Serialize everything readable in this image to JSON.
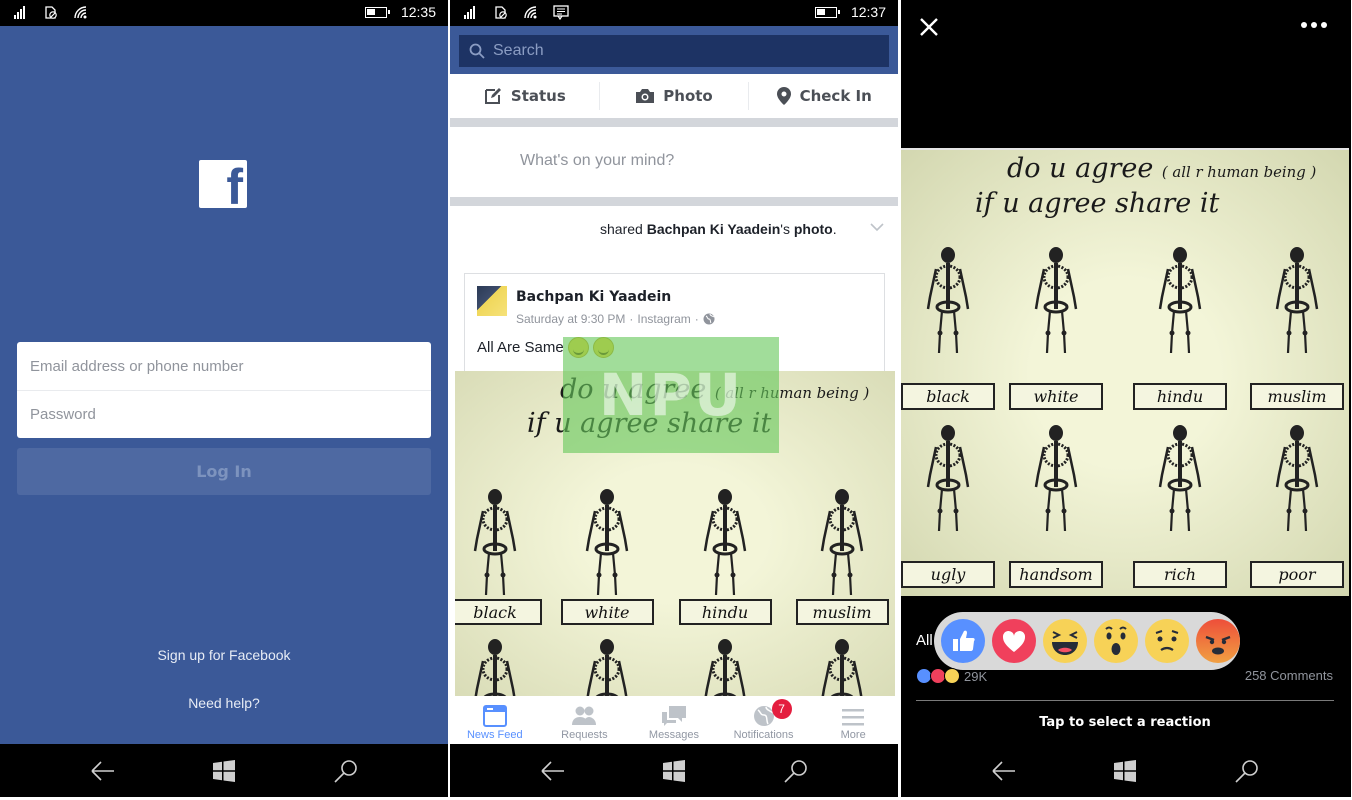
{
  "screens": {
    "login": {
      "status": {
        "time": "12:35"
      },
      "email_placeholder": "Email address or phone number",
      "password_placeholder": "Password",
      "login_label": "Log In",
      "signup_label": "Sign up for Facebook",
      "help_label": "Need help?",
      "logo_letter": "f"
    },
    "feed": {
      "status": {
        "time": "12:37"
      },
      "search_placeholder": "Search",
      "composer": {
        "status_label": "Status",
        "photo_label": "Photo",
        "checkin_label": "Check In",
        "prompt": "What's on your mind?"
      },
      "story": {
        "shared_prefix": "shared ",
        "shared_page": "Bachpan Ki Yaadein",
        "shared_possessive": "'s ",
        "shared_object": "photo",
        "shared_suffix": ".",
        "author": "Bachpan Ki Yaadein",
        "time": "Saturday at 9:30 PM",
        "source": "Instagram",
        "dot": "·",
        "text": "All Are Same",
        "watermark": "NPU"
      },
      "tabs": [
        {
          "label": "News Feed",
          "icon": "news-feed-icon",
          "active": true
        },
        {
          "label": "Requests",
          "icon": "friend-requests-icon",
          "active": false
        },
        {
          "label": "Messages",
          "icon": "messages-icon",
          "active": false
        },
        {
          "label": "Notifications",
          "icon": "globe-icon",
          "active": false,
          "badge": "7"
        },
        {
          "label": "More",
          "icon": "hamburger-icon",
          "active": false
        }
      ]
    },
    "viewer": {
      "all_label": "All",
      "reactions": [
        "Like",
        "Love",
        "Haha",
        "Wow",
        "Sad",
        "Angry"
      ],
      "reaction_count": "29K",
      "comments": "258 Comments",
      "tap_hint": "Tap to select a reaction"
    }
  },
  "meme": {
    "title_main": "do u agree",
    "title_sub": "( all r human being )",
    "title_line2": "if u agree share it",
    "row1": [
      "black",
      "white",
      "hindu",
      "muslim"
    ],
    "row2": [
      "ugly",
      "handsom",
      "rich",
      "poor"
    ]
  },
  "colors": {
    "brand_blue": "#3b5998",
    "search_bg": "#1d3364",
    "active_tab": "#5890ff",
    "badge_red": "#e41e3f"
  }
}
